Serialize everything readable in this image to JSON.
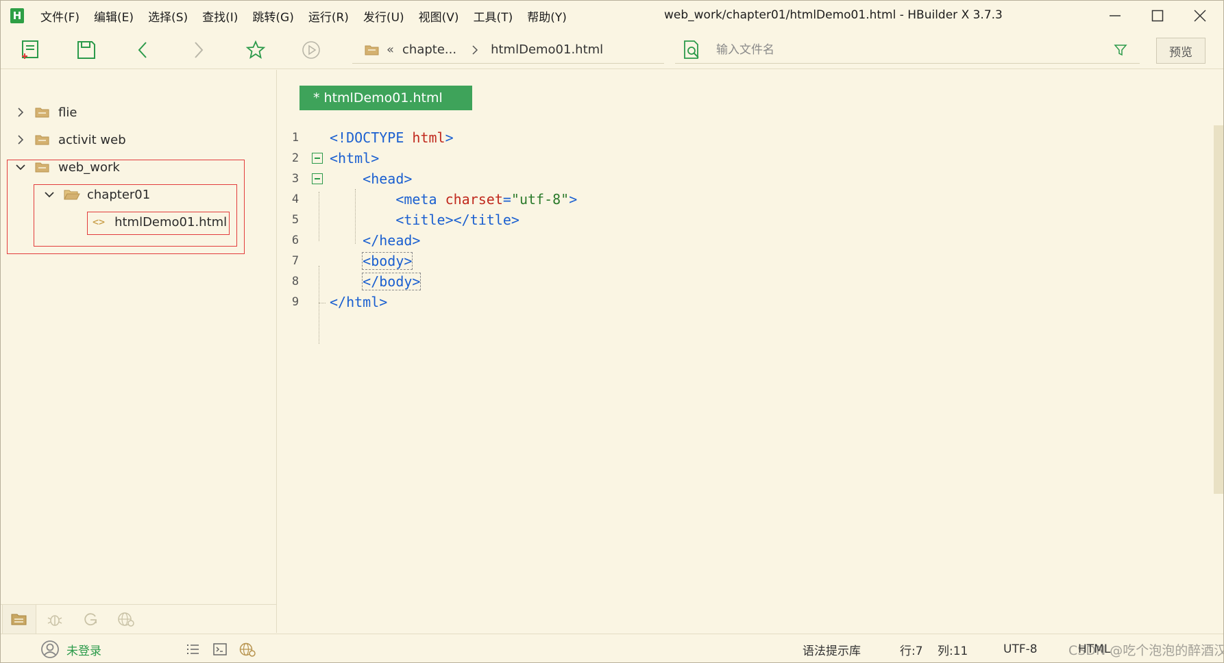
{
  "app": {
    "logo_letter": "H",
    "window_title": "web_work/chapter01/htmlDemo01.html - HBuilder X 3.7.3",
    "accent_color": "#3ea35a",
    "highlight_color": "#e23b3b"
  },
  "menu": [
    {
      "label": "文件(F)"
    },
    {
      "label": "编辑(E)"
    },
    {
      "label": "选择(S)"
    },
    {
      "label": "查找(I)"
    },
    {
      "label": "跳转(G)"
    },
    {
      "label": "运行(R)"
    },
    {
      "label": "发行(U)"
    },
    {
      "label": "视图(V)"
    },
    {
      "label": "工具(T)"
    },
    {
      "label": "帮助(Y)"
    }
  ],
  "toolbar": {
    "breadcrumb_folder": "chapte...",
    "breadcrumb_file": "htmlDemo01.html",
    "search_placeholder": "输入文件名",
    "preview_label": "预览",
    "icons": [
      "new-file-icon",
      "save-icon",
      "back-icon",
      "forward-icon",
      "favorite-star-icon",
      "run-icon"
    ]
  },
  "sidebar": {
    "tree": [
      {
        "label": "flie",
        "expanded": false,
        "level": 0,
        "type": "folder"
      },
      {
        "label": "activit web",
        "expanded": false,
        "level": 0,
        "type": "folder"
      },
      {
        "label": "web_work",
        "expanded": true,
        "level": 0,
        "type": "folder"
      },
      {
        "label": "chapter01",
        "expanded": true,
        "level": 1,
        "type": "folder"
      },
      {
        "label": "htmlDemo01.html",
        "level": 2,
        "type": "html-file",
        "file_icon_text": "<>"
      }
    ],
    "bottom_tabs": [
      "project-manager-icon",
      "debug-icon",
      "git-icon",
      "web-icon"
    ]
  },
  "editor": {
    "tab_label": "* htmlDemo01.html",
    "lines": [
      {
        "n": "1",
        "parts": [
          {
            "t": "tag",
            "v": "<!DOCTYPE "
          },
          {
            "t": "kw",
            "v": "html"
          },
          {
            "t": "tag",
            "v": ">"
          }
        ]
      },
      {
        "n": "2",
        "parts": [
          {
            "t": "tag",
            "v": "<html>"
          }
        ]
      },
      {
        "n": "3",
        "parts": [
          {
            "t": "ws",
            "v": "    "
          },
          {
            "t": "tag",
            "v": "<head>"
          }
        ]
      },
      {
        "n": "4",
        "parts": [
          {
            "t": "ws",
            "v": "        "
          },
          {
            "t": "tag",
            "v": "<meta "
          },
          {
            "t": "attr",
            "v": "charset"
          },
          {
            "t": "tag",
            "v": "="
          },
          {
            "t": "str",
            "v": "\"utf-8\""
          },
          {
            "t": "tag",
            "v": ">"
          }
        ]
      },
      {
        "n": "5",
        "parts": [
          {
            "t": "ws",
            "v": "        "
          },
          {
            "t": "tag",
            "v": "<title></title>"
          }
        ]
      },
      {
        "n": "6",
        "parts": [
          {
            "t": "ws",
            "v": "    "
          },
          {
            "t": "tag",
            "v": "</head>"
          }
        ]
      },
      {
        "n": "7",
        "parts": [
          {
            "t": "ws",
            "v": "    "
          },
          {
            "t": "match",
            "v": "<body>"
          }
        ]
      },
      {
        "n": "8",
        "parts": [
          {
            "t": "ws",
            "v": "    "
          },
          {
            "t": "match",
            "v": "</body>"
          }
        ]
      },
      {
        "n": "9",
        "parts": [
          {
            "t": "tag",
            "v": "</html>"
          }
        ]
      }
    ]
  },
  "status": {
    "login": "未登录",
    "syntax_lib": "语法提示库",
    "row": "行:7",
    "col": "列:11",
    "encoding": "UTF-8",
    "language": "HTML",
    "watermark": "CSDN @吃个泡泡的醉酒汉"
  }
}
